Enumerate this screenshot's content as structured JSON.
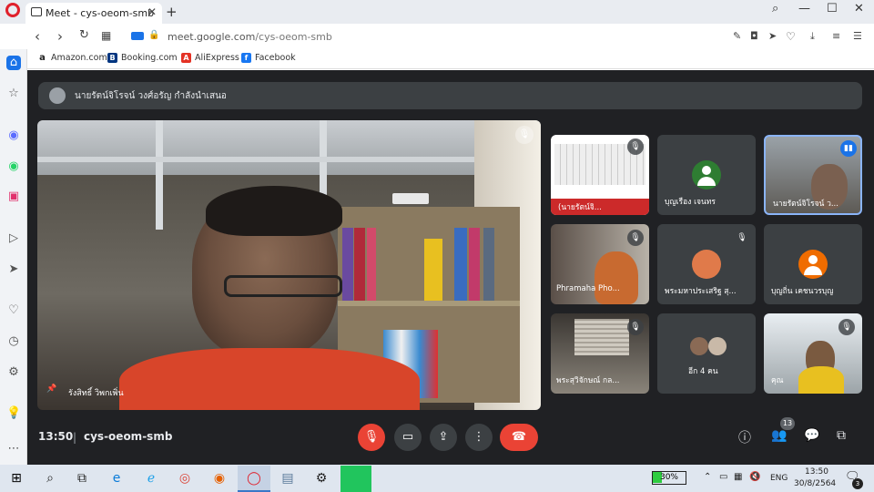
{
  "browser": {
    "tab_title": "Meet - cys-oeom-smb",
    "url_domain": "meet.google.com",
    "url_path": "/cys-oeom-smb"
  },
  "bookmarks": [
    {
      "label": "Amazon.com",
      "icon": "amazon-icon",
      "color": "#222222"
    },
    {
      "label": "Booking.com",
      "icon": "booking-icon",
      "color": "#003580"
    },
    {
      "label": "AliExpress",
      "icon": "aliexpress-icon",
      "color": "#e43225"
    },
    {
      "label": "Facebook",
      "icon": "facebook-icon",
      "color": "#1877f2"
    }
  ],
  "meet": {
    "presenter_text": "นายรัตน์จิโรจน์ วงศ์อรัญ กำลังนำเสนอ",
    "main_name": "รังสิทธิ์ วิพกเพิ่น",
    "time": "13:50",
    "code": "cys-oeom-smb",
    "participants_count": "13",
    "end_call_color": "#ea4335",
    "mic_off_color": "#ea4335"
  },
  "tiles": [
    {
      "name": "(นายรัตน์จิ...",
      "type": "video"
    },
    {
      "name": "บุญเรือง เจนทร",
      "type": "avatar",
      "color": "#2e7d32"
    },
    {
      "name": "นายรัตน์จิโรจน์ ว...",
      "type": "video",
      "active": true
    },
    {
      "name": "Phramaha Pho...",
      "type": "video"
    },
    {
      "name": "พระมหาประเสริฐ สุ...",
      "type": "photo"
    },
    {
      "name": "บุญถิ่น เคชนวรบุญ",
      "type": "avatar",
      "color": "#ef6c00"
    },
    {
      "name": "พระสุวิจักษณ์ กล...",
      "type": "video"
    },
    {
      "name": "อีก 4 คน",
      "type": "more"
    },
    {
      "name": "คุณ",
      "type": "video"
    }
  ],
  "taskbar": {
    "battery": "30%",
    "lang": "ENG",
    "time": "13:50",
    "date": "30/8/2564",
    "notif_count": "3"
  }
}
